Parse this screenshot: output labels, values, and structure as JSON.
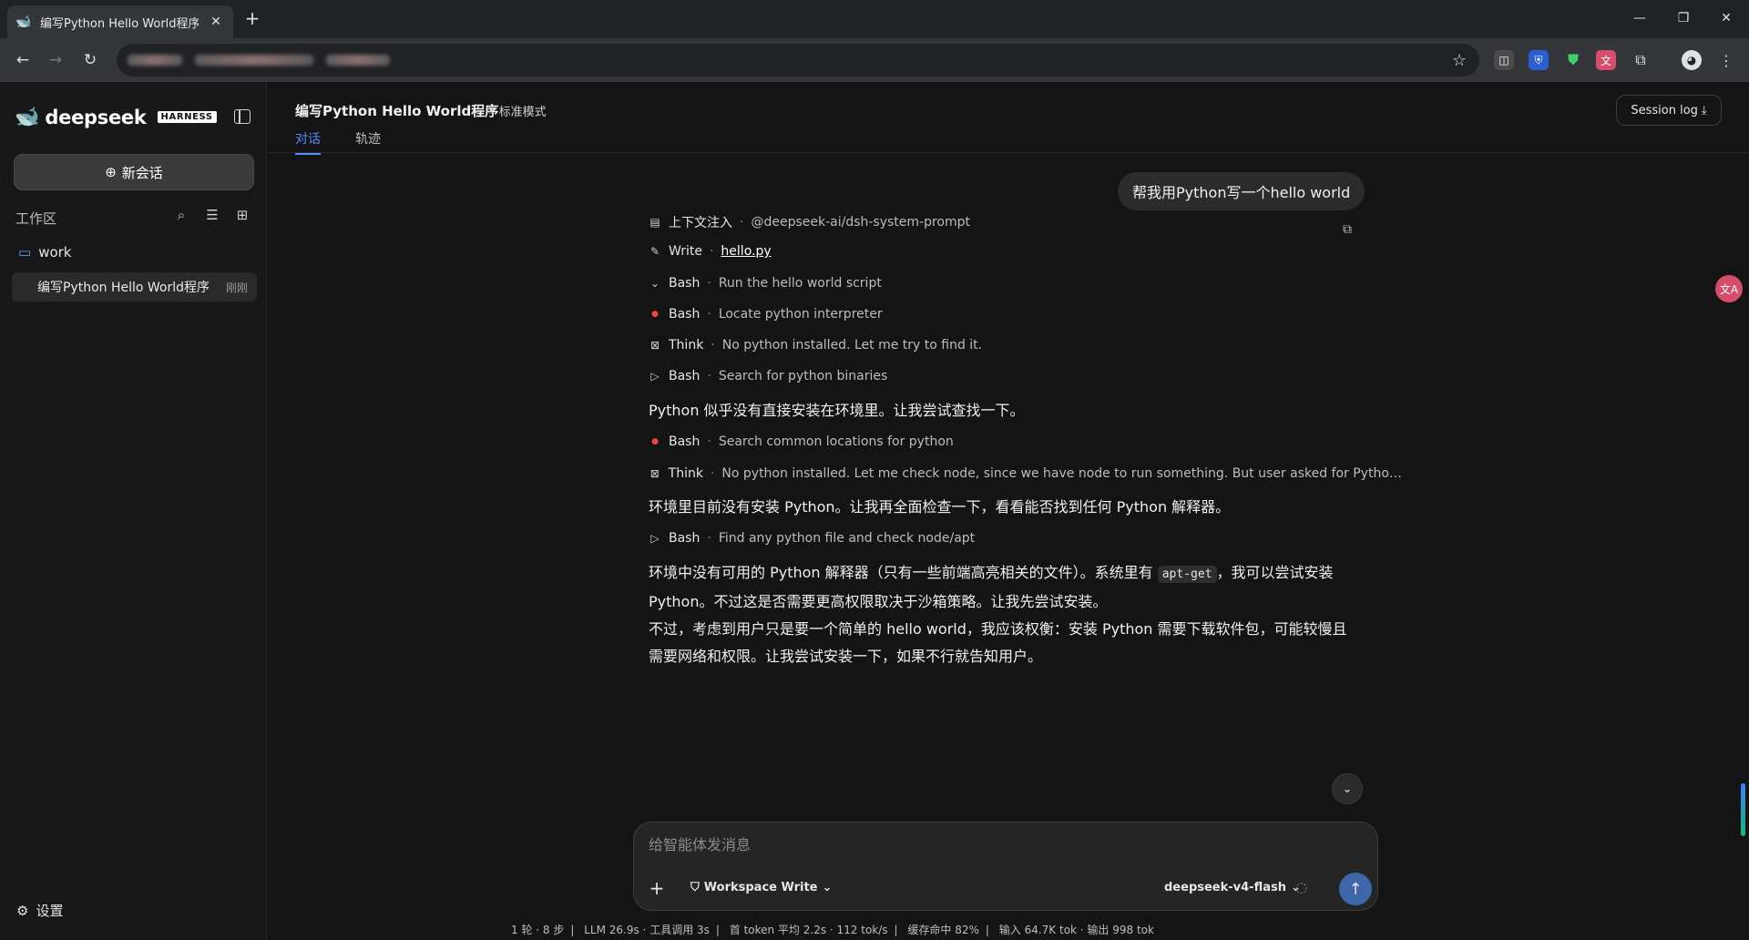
{
  "browser": {
    "tab_title": "编写Python Hello World程序 —",
    "tab_close": "✕",
    "new_tab": "+",
    "minimize": "—",
    "restore": "❐",
    "close": "✕"
  },
  "sidebar": {
    "brand": "deepseek",
    "badge": "HARNESS",
    "new_chat_label": "新会话",
    "workspace_title": "工作区",
    "folder_name": "work",
    "session_title": "编写Python Hello World程序",
    "session_time": "刚刚",
    "settings_label": "设置"
  },
  "header": {
    "title": "编写Python Hello World程序",
    "mode": "标准模式",
    "tabs": [
      {
        "label": "对话"
      },
      {
        "label": "轨迹"
      }
    ],
    "session_log": "Session log"
  },
  "chat": {
    "user_message": "帮我用Python写一个hello world",
    "steps": [
      {
        "icon": "document-icon",
        "kind": "上下文注入",
        "desc": "@deepseek-ai/dsh-system-prompt"
      },
      {
        "icon": "pencil-icon",
        "kind": "Write",
        "desc": "hello.py"
      },
      {
        "icon": "chevron-down-icon",
        "kind": "Bash",
        "desc": "Run the hello world script"
      },
      {
        "icon": "error-dot-icon",
        "kind": "Bash",
        "desc": "Locate python interpreter"
      },
      {
        "icon": "think-icon",
        "kind": "Think",
        "desc": "No python installed. Let me try to find it."
      },
      {
        "icon": "terminal-icon",
        "kind": "Bash",
        "desc": "Search for python binaries"
      },
      {
        "icon": "error-dot-icon",
        "kind": "Bash",
        "desc": "Search common locations for python"
      },
      {
        "icon": "think-icon",
        "kind": "Think",
        "desc": "No python installed. Let me check node, since we have node to run something. But user asked for Python h..."
      },
      {
        "icon": "terminal-icon",
        "kind": "Bash",
        "desc": "Find any python file and check node/apt"
      }
    ],
    "paragraphs": [
      "Python 似乎没有直接安装在环境里。让我尝试查找一下。",
      "环境里目前没有安装 Python。让我再全面检查一下，看看能否找到任何 Python 解释器。",
      "不过，考虑到用户只是要一个简单的 hello world，我应该权衡：安装 Python 需要下载软件包，可能较慢且需要网络和权限。让我尝试安装一下，如果不行就告知用户。"
    ],
    "para_apt": {
      "before": "环境中没有可用的 Python 解释器（只有一些前端高亮相关的文件）。系统里有 ",
      "code": "apt-get",
      "after": "，我可以尝试安装 Python。不过这是否需要更高权限取决于沙箱策略。让我先尝试安装。"
    }
  },
  "composer": {
    "placeholder": "给智能体发消息",
    "permission": "Workspace Write",
    "model": "deepseek-v4-flash"
  },
  "stats": [
    "1 轮 · 8 步",
    "LLM 26.9s · 工具调用 3s",
    "首 token 平均 2.2s · 112 tok/s",
    "缓存命中 82%",
    "输入 64.7K tok · 输出 998 tok"
  ],
  "colors": {
    "accent": "#4f8cff",
    "error_dot": "#ef4444",
    "send_button": "#3e66a8"
  }
}
